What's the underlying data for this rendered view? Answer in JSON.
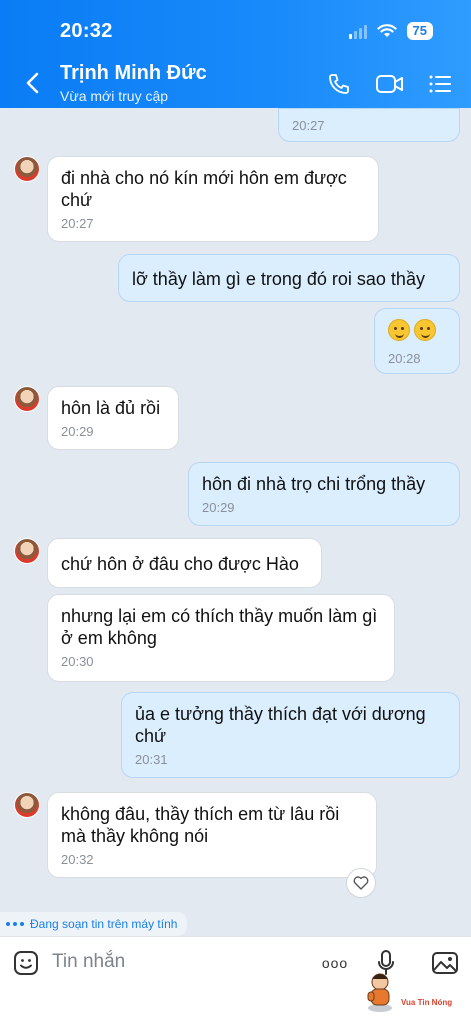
{
  "status_bar": {
    "time": "20:32",
    "battery": "75"
  },
  "header": {
    "name": "Trịnh Minh Đức",
    "status": "Vừa mới truy cập"
  },
  "messages": [
    {
      "time": "20:27"
    },
    {
      "text": "đi nhà cho nó kín mới hôn em được chứ",
      "time": "20:27"
    },
    {
      "text": "lỡ thầy làm gì e trong đó roi sao thầy"
    },
    {
      "time": "20:28"
    },
    {
      "text": "hôn là đủ rồi",
      "time": "20:29"
    },
    {
      "text": "hôn đi nhà trọ chi trổng thầy",
      "time": "20:29"
    },
    {
      "text": "chứ hôn ở đâu cho được Hào"
    },
    {
      "text": "nhưng lại em có thích thầy muốn làm gì ở em không",
      "time": "20:30"
    },
    {
      "text": "ủa e tưởng thầy thích đạt với dương chứ",
      "time": "20:31"
    },
    {
      "text": "không đâu, thầy thích em từ lâu rồi mà thầy không nói",
      "time": "20:32"
    }
  ],
  "typing_indicator": "Đang soạn tin trên máy tính",
  "composer": {
    "placeholder": "Tin nhắn",
    "more_label": "ooo"
  },
  "watermark": {
    "text": "Vua Tin Nóng"
  },
  "colors": {
    "header": "#1a8bfa",
    "outgoing_bubble": "#dbeefe",
    "incoming_bubble": "#ffffff",
    "background": "#e2e9f1"
  },
  "icons": [
    "back-icon",
    "phone-icon",
    "video-call-icon",
    "menu-list-icon",
    "heart-icon",
    "sticker-icon",
    "more-icon",
    "microphone-icon",
    "image-icon"
  ]
}
